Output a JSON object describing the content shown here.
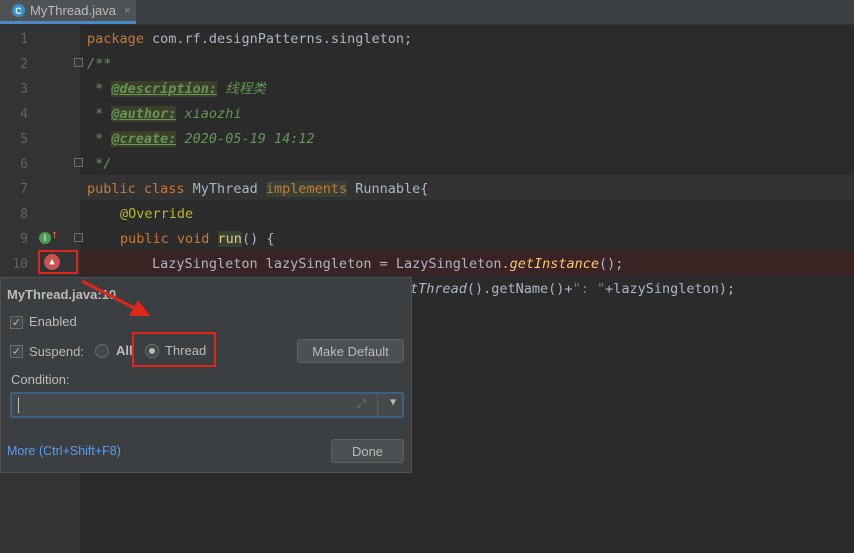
{
  "tab": {
    "icon": "C",
    "label": "MyThread.java",
    "close": "×"
  },
  "line_numbers": [
    "1",
    "2",
    "3",
    "4",
    "5",
    "6",
    "7",
    "8",
    "9",
    "10"
  ],
  "code": {
    "l1_kw": "package",
    "l1_rest": " com.rf.designPatterns.singleton;",
    "l2": "/**",
    "l3_pre": " * ",
    "l3_tag": "@description:",
    "l3_val": " 线程类",
    "l4_pre": " * ",
    "l4_tag": "@author:",
    "l4_val": " xiaozhi",
    "l5_pre": " * ",
    "l5_tag": "@create:",
    "l5_val": " 2020-05-19 14:12",
    "l6": " */",
    "l7_kw": "public class",
    "l7_name": " MyThread ",
    "l7_impl": "implements",
    "l7_rest": " Runnable{",
    "l8": "@Override",
    "l9_kw": "public void",
    "l9_method": "run",
    "l9_rest": "() {",
    "l10_pre": "LazySingleton lazySingleton = LazySingleton.",
    "l10_m": "getInstance",
    "l10_post": "();",
    "l11_it": "tThread",
    "l11_mid": "().getName()+",
    "l11_str": "\": \"",
    "l11_end": "+lazySingleton);"
  },
  "popup": {
    "title": "MyThread.java:10",
    "enabled_label": "Enabled",
    "enabled_checked": "✓",
    "suspend_label": "Suspend:",
    "suspend_checked": "✓",
    "all_label": "All",
    "thread_label": "Thread",
    "make_default_label": "Make Default",
    "condition_label": "Condition:",
    "condition_value": "",
    "expand_icon": "⤢",
    "dropdown_icon": "▼",
    "more_label": "More (Ctrl+Shift+F8)",
    "done_label": "Done"
  }
}
